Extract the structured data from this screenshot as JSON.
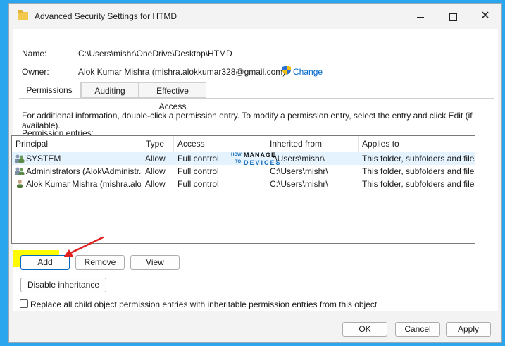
{
  "window": {
    "title": "Advanced Security Settings for HTMD"
  },
  "details": {
    "name_label": "Name:",
    "name_value": "C:\\Users\\mishr\\OneDrive\\Desktop\\HTMD",
    "owner_label": "Owner:",
    "owner_value": "Alok Kumar Mishra (mishra.alokkumar328@gmail.com)",
    "change_link": "Change"
  },
  "tabs": [
    {
      "label": "Permissions",
      "active": true
    },
    {
      "label": "Auditing",
      "active": false
    },
    {
      "label": "Effective Access",
      "active": false
    }
  ],
  "permissions": {
    "info_text": "For additional information, double-click a permission entry. To modify a permission entry, select the entry and click Edit (if available).",
    "entries_label": "Permission entries:",
    "columns": [
      "Principal",
      "Type",
      "Access",
      "Inherited from",
      "Applies to"
    ],
    "rows": [
      {
        "principal": "SYSTEM",
        "type": "Allow",
        "access": "Full control",
        "inherited": ":\\Users\\mishr\\",
        "applies": "This folder, subfolders and files",
        "icon": "group-users-icon"
      },
      {
        "principal": "Administrators (Alok\\Administr...",
        "type": "Allow",
        "access": "Full control",
        "inherited": "C:\\Users\\mishr\\",
        "applies": "This folder, subfolders and files",
        "icon": "group-users-icon"
      },
      {
        "principal": "Alok Kumar Mishra (mishra.alo...",
        "type": "Allow",
        "access": "Full control",
        "inherited": "C:\\Users\\mishr\\",
        "applies": "This folder, subfolders and files",
        "icon": "user-icon"
      }
    ]
  },
  "watermark": {
    "how": "HOW",
    "to": "TO",
    "manage": "MANAGE",
    "devices": "DEVICES"
  },
  "buttons": {
    "add": "Add",
    "remove": "Remove",
    "view": "View",
    "disable_inheritance": "Disable inheritance",
    "ok": "OK",
    "cancel": "Cancel",
    "apply": "Apply"
  },
  "replace_checkbox": {
    "label": "Replace all child object permission entries with inheritable permission entries from this object",
    "checked": false
  },
  "colors": {
    "background": "#2aa6ee",
    "highlight": "#fffb00",
    "annotation_arrow": "#e02020",
    "link": "#0066cc",
    "selection": "#e5f3ff"
  }
}
